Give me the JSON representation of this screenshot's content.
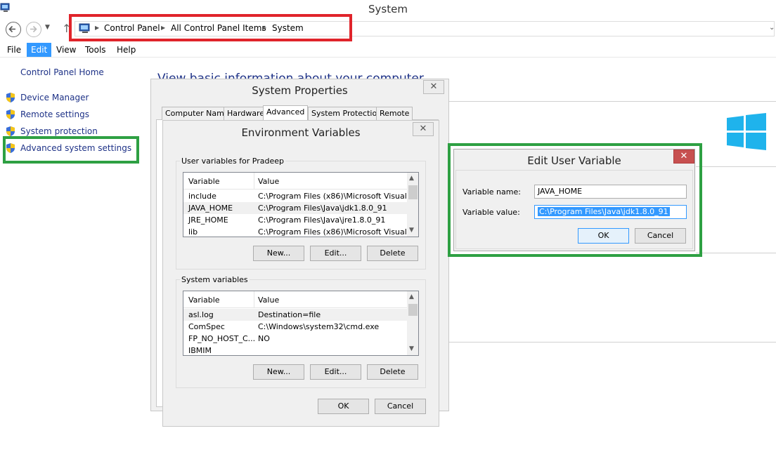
{
  "window": {
    "title": "System"
  },
  "address_bar": {
    "crumbs": [
      "Control Panel",
      "All Control Panel Items",
      "System"
    ]
  },
  "menubar": {
    "items": [
      "File",
      "Edit",
      "View",
      "Tools",
      "Help"
    ],
    "active": "Edit"
  },
  "sidebar": {
    "home": "Control Panel Home",
    "items": [
      {
        "label": "Device Manager",
        "icon": "uac-shield-icon"
      },
      {
        "label": "Remote settings",
        "icon": "uac-shield-icon"
      },
      {
        "label": "System protection",
        "icon": "uac-shield-icon"
      },
      {
        "label": "Advanced system settings",
        "icon": "uac-shield-icon"
      }
    ]
  },
  "main": {
    "heading": "View basic information about your computer"
  },
  "system_properties": {
    "title": "System Properties",
    "tabs": [
      "Computer Name",
      "Hardware",
      "Advanced",
      "System Protection",
      "Remote"
    ],
    "selected_tab": "Advanced",
    "close": "✕"
  },
  "env_vars": {
    "title": "Environment Variables",
    "close": "✕",
    "user_group_label": "User variables for Pradeep",
    "system_group_label": "System variables",
    "columns": [
      "Variable",
      "Value"
    ],
    "user_rows": [
      [
        "include",
        "C:\\Program Files (x86)\\Microsoft Visual ..."
      ],
      [
        "JAVA_HOME",
        "C:\\Program Files\\Java\\jdk1.8.0_91"
      ],
      [
        "JRE_HOME",
        "C:\\Program Files\\Java\\jre1.8.0_91"
      ],
      [
        "lib",
        "C:\\Program Files (x86)\\Microsoft Visual ..."
      ]
    ],
    "system_rows": [
      [
        "asl.log",
        "Destination=file"
      ],
      [
        "ComSpec",
        "C:\\Windows\\system32\\cmd.exe"
      ],
      [
        "FP_NO_HOST_C...",
        "NO"
      ],
      [
        "IBMIM",
        ""
      ]
    ],
    "buttons": {
      "new": "New...",
      "edit": "Edit...",
      "delete": "Delete",
      "ok": "OK",
      "cancel": "Cancel"
    }
  },
  "edit_var": {
    "title": "Edit User Variable",
    "close": "✕",
    "name_label": "Variable name:",
    "value_label": "Variable value:",
    "name_value": "JAVA_HOME",
    "value_value": "C:\\Program Files\\Java\\jdk1.8.0_91",
    "ok": "OK",
    "cancel": "Cancel"
  },
  "colors": {
    "red_highlight": "#e0242b",
    "green_highlight": "#2ea043",
    "link": "#1e3287",
    "selection": "#3399ff",
    "close_red": "#c75050"
  }
}
